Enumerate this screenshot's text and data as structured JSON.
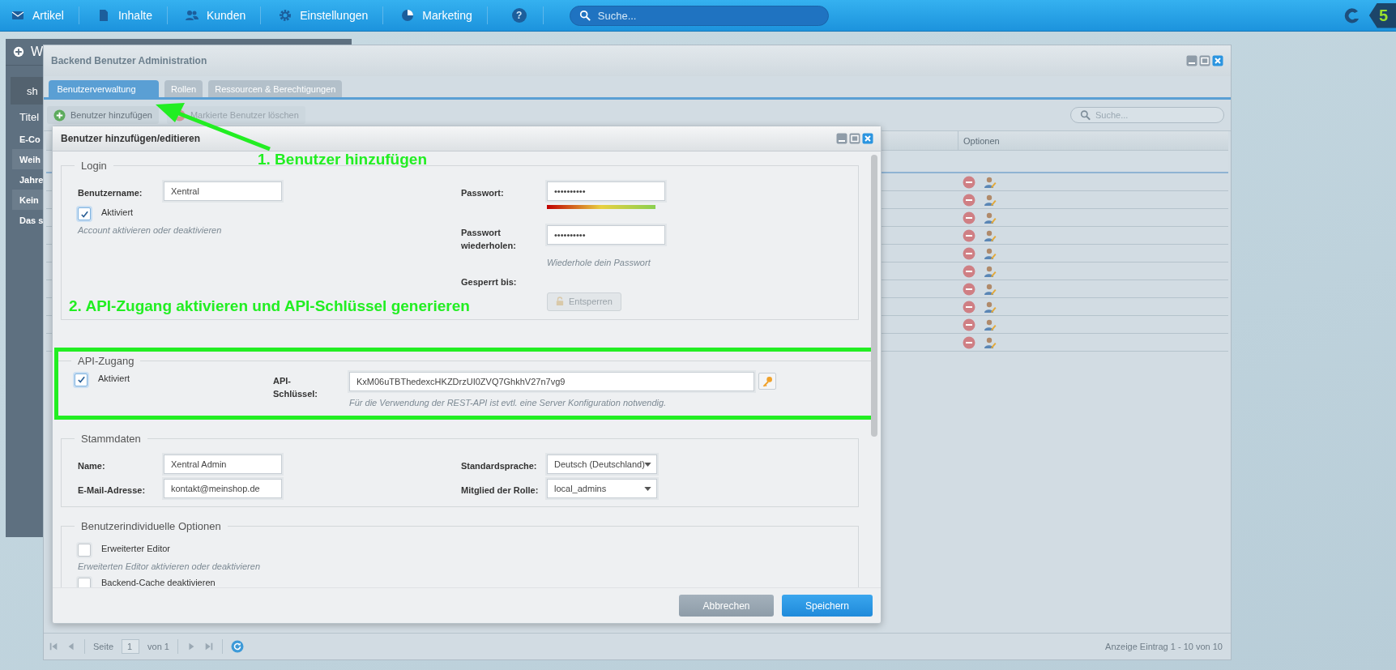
{
  "top_nav": {
    "items": [
      {
        "label": "Artikel",
        "kind": "mail"
      },
      {
        "label": "Inhalte",
        "kind": "doc"
      },
      {
        "label": "Kunden",
        "kind": "users"
      },
      {
        "label": "Einstellungen",
        "kind": "gear"
      },
      {
        "label": "Marketing",
        "kind": "pie"
      }
    ],
    "help": "?",
    "search": {
      "placeholder": "Suche..."
    },
    "brand_mark": "5"
  },
  "background_window": {
    "title": "W",
    "subtitle": "sh",
    "rows": [
      {
        "text": "Titel",
        "kind": "header"
      },
      {
        "text": "E-Co",
        "kind": "plain"
      },
      {
        "text": "Weih",
        "kind": "shaded"
      },
      {
        "text": "Jahre",
        "kind": "plain"
      },
      {
        "text": "Kein",
        "kind": "shaded"
      },
      {
        "text": "Das s",
        "kind": "plain"
      }
    ]
  },
  "window": {
    "title": "Backend Benutzer Administration",
    "tabs": [
      {
        "label": "Benutzerverwaltung",
        "selected": true
      },
      {
        "label": "Rollen",
        "selected": false
      },
      {
        "label": "Ressourcen & Berechtigungen",
        "selected": false
      }
    ],
    "toolbar": [
      {
        "label": "Benutzer hinzufügen",
        "kind": "add",
        "disabled": false
      },
      {
        "label": "Markierte Benutzer löschen",
        "kind": "delete",
        "disabled": true
      }
    ],
    "search": {
      "placeholder": "Suche..."
    },
    "table": {
      "columns": [
        "Optionen"
      ],
      "rows": [
        {
          "deletable": true,
          "editable": true
        },
        {
          "deletable": true,
          "editable": true
        },
        {
          "deletable": true,
          "editable": true
        },
        {
          "deletable": true,
          "editable": true
        },
        {
          "deletable": true,
          "editable": true
        },
        {
          "deletable": true,
          "editable": true
        },
        {
          "deletable": true,
          "editable": true
        },
        {
          "deletable": true,
          "editable": true
        },
        {
          "deletable": true,
          "editable": true
        },
        {
          "deletable": true,
          "editable": true
        }
      ]
    },
    "pager": {
      "page_label": "Seite",
      "page": "1",
      "of": "von 1",
      "info": "Anzeige Eintrag 1 - 10 von 10"
    }
  },
  "dialog": {
    "title": "Benutzer hinzufügen/editieren",
    "login": {
      "legend": "Login",
      "username": {
        "label": "Benutzername:",
        "value": "Xentral"
      },
      "active": {
        "label": "Aktiviert",
        "checked": true,
        "hint": "Account aktivieren oder deaktivieren"
      },
      "password": {
        "label": "Passwort:",
        "value": "••••••••••",
        "level": 1
      },
      "password_repeat": {
        "label": "Passwort wiederholen:",
        "value": "••••••••••",
        "hint": "Wiederhole dein Passwort"
      },
      "locked_until": {
        "label": "Gesperrt bis:",
        "button": {
          "label": "Entsperren",
          "disabled": true
        }
      }
    },
    "api": {
      "legend": "API-Zugang",
      "active": {
        "label": "Aktiviert",
        "checked": true
      },
      "key": {
        "label": "API-Schlüssel:",
        "value": "KxM06uTBThedexcHKZDrzUI0ZVQ7GhkhV27n7vg9",
        "hint": "Für die Verwendung der REST-API ist evtl. eine Server Konfiguration notwendig."
      }
    },
    "master_data": {
      "legend": "Stammdaten",
      "name": {
        "label": "Name:",
        "value": "Xentral Admin"
      },
      "email": {
        "label": "E-Mail-Adresse:",
        "value": "kontakt@meinshop.de"
      },
      "language": {
        "label": "Standardsprache:",
        "value": "Deutsch (Deutschland)"
      },
      "role": {
        "label": "Mitglied der Rolle:",
        "value": "local_admins"
      }
    },
    "options": {
      "legend": "Benutzerindividuelle Optionen",
      "items": [
        {
          "label": "Erweiterter Editor",
          "checked": false,
          "hint": "Erweiterten Editor aktivieren oder deaktivieren"
        },
        {
          "label": "Backend-Cache deaktivieren",
          "checked": false
        }
      ]
    },
    "buttons": [
      {
        "label": "Abbrechen",
        "kind": "secondary"
      },
      {
        "label": "Speichern",
        "kind": "primary"
      }
    ]
  },
  "annotations": [
    {
      "text": "1. Benutzer hinzufügen",
      "kind": "step"
    },
    {
      "text": "2. API-Zugang aktivieren und API-Schlüssel generieren",
      "kind": "step"
    }
  ]
}
